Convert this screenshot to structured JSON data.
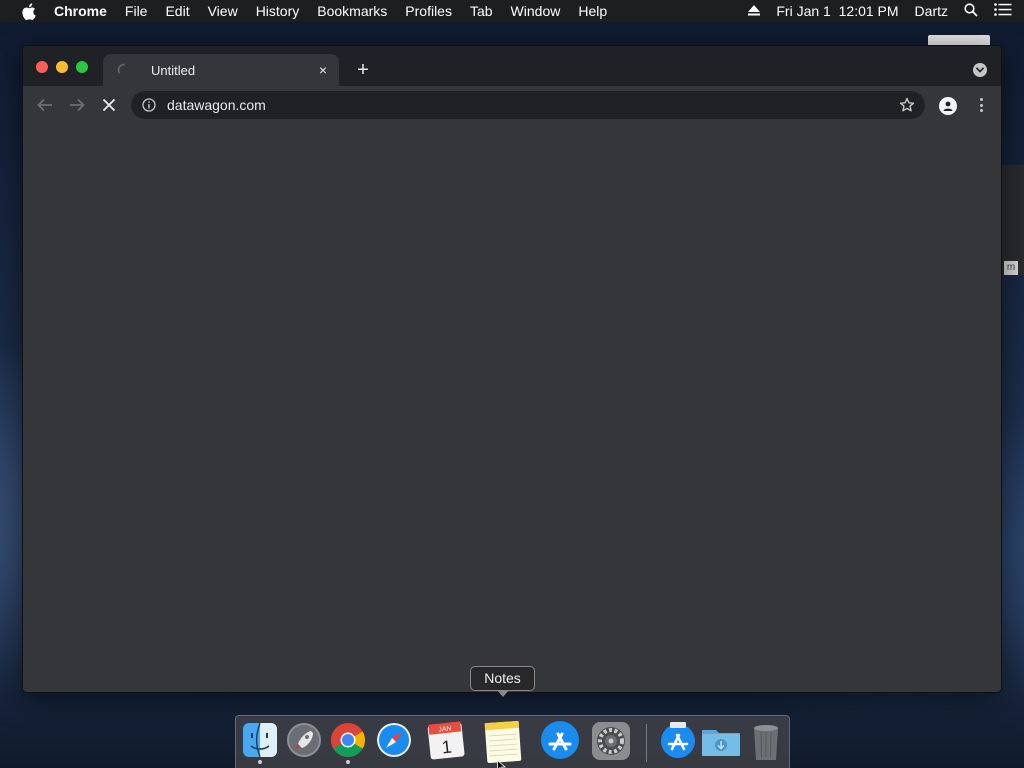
{
  "menubar": {
    "apple_icon": "apple-icon",
    "app_name": "Chrome",
    "items": [
      "File",
      "Edit",
      "View",
      "History",
      "Bookmarks",
      "Profiles",
      "Tab",
      "Window",
      "Help"
    ],
    "datetime": "Fri Jan 1  12:01 PM",
    "user": "Dartz",
    "status_icons": [
      "eject-icon",
      "spotlight-search-icon",
      "notification-center-icon"
    ]
  },
  "browser": {
    "tab": {
      "title": "Untitled",
      "loading": true
    },
    "new_tab_label": "+",
    "close_label": "×",
    "address_bar": {
      "url": "datawagon.com"
    },
    "nav": {
      "back": "back-arrow-icon",
      "forward": "forward-arrow-icon",
      "stop": "stop-icon"
    }
  },
  "tooltip": {
    "text": "Notes"
  },
  "calendar": {
    "month": "JAN",
    "day": "1"
  },
  "dock": {
    "apps": [
      "Finder",
      "Launchpad",
      "Google Chrome",
      "Safari",
      "Calendar",
      "Notes",
      "App Store",
      "System Preferences"
    ],
    "others": [
      "App Store",
      "Downloads",
      "Trash"
    ]
  },
  "colors": {
    "window_bg": "#35363a",
    "tabstrip_bg": "#202124",
    "omnibox_bg": "#202124",
    "text": "#e8eaed",
    "traffic_red": "#fe5f57",
    "traffic_yellow": "#febc2e",
    "traffic_green": "#28c840"
  }
}
